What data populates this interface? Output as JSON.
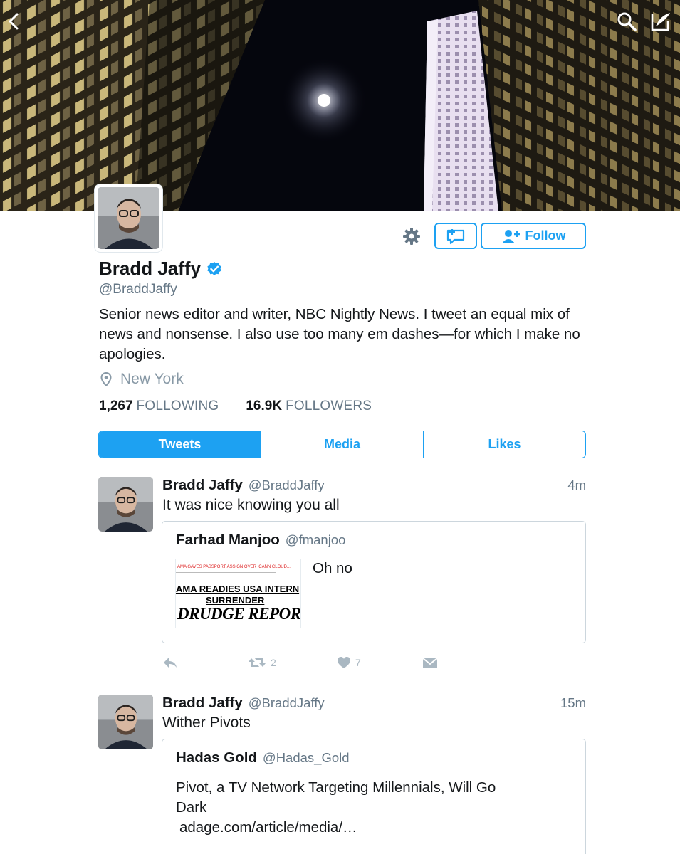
{
  "profile": {
    "name": "Bradd Jaffy",
    "handle": "@BraddJaffy",
    "bio": "Senior news editor and writer, NBC Nightly News. I tweet an equal mix of news and nonsense. I also use too many em dashes—for which I make no apologies.",
    "location": "New York",
    "following_count": "1,267",
    "following_label": "FOLLOWING",
    "followers_count": "16.9K",
    "followers_label": "FOLLOWERS",
    "verified": true
  },
  "buttons": {
    "follow_label": "Follow"
  },
  "tabs": [
    {
      "label": "Tweets",
      "active": true
    },
    {
      "label": "Media",
      "active": false
    },
    {
      "label": "Likes",
      "active": false
    }
  ],
  "tweets": [
    {
      "author": "Bradd Jaffy",
      "handle": "@BraddJaffy",
      "time": "4m",
      "text": "It was nice knowing you all",
      "quote": {
        "author": "Farhad Manjoo",
        "handle": "@fmanjoo",
        "text": "Oh no",
        "image": {
          "small_text": "AMA GAVES PASSPORT ASSIGN OVER ICANN CLOUD...",
          "headline_1": "AMA READIES USA INTERN",
          "headline_2": "SURRENDER",
          "logo": "DRUDGE REPORT"
        }
      },
      "retweets": "2",
      "likes": "7"
    },
    {
      "author": "Bradd Jaffy",
      "handle": "@BraddJaffy",
      "time": "15m",
      "text": "Wither Pivots",
      "quote": {
        "author": "Hadas Gold",
        "handle": "@Hadas_Gold",
        "text_line1": "Pivot, a TV Network Targeting Millennials, Will Go",
        "text_line2": "Dark",
        "link": "adage.com/article/media/…"
      }
    }
  ],
  "colors": {
    "accent": "#1da1f2",
    "text": "#14171a",
    "secondary": "#657786",
    "icon_gray": "#aab8c2"
  },
  "icons": [
    "back-chevron-icon",
    "search-icon",
    "compose-icon",
    "gear-icon",
    "direct-message-icon",
    "add-user-icon",
    "verified-badge-icon",
    "location-pin-icon",
    "reply-icon",
    "retweet-icon",
    "like-icon",
    "share-icon"
  ]
}
